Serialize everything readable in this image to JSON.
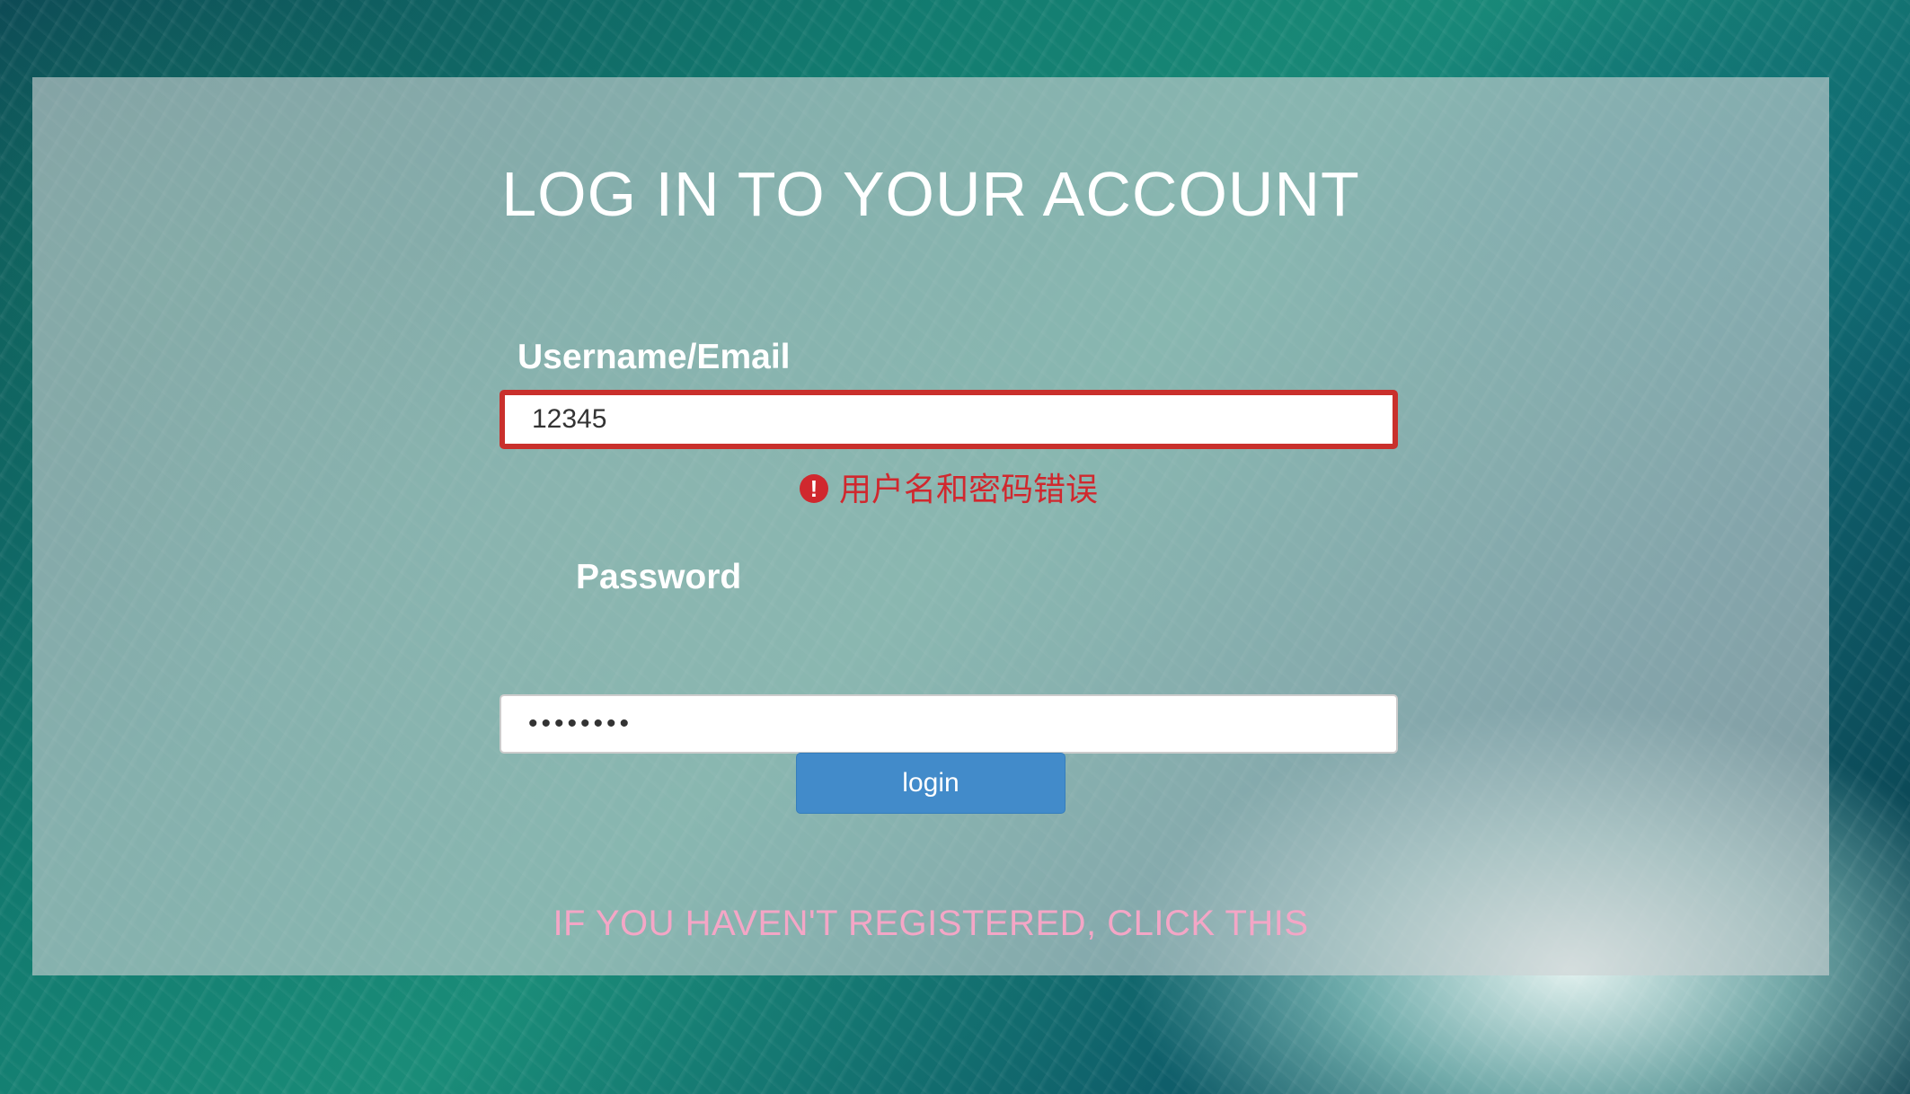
{
  "page": {
    "title": "LOG IN TO YOUR ACCOUNT"
  },
  "form": {
    "username": {
      "label": "Username/Email",
      "value": "12345",
      "error": "用户名和密码错误",
      "error_icon": "exclamation-circle-icon",
      "error_color": "#d0282e"
    },
    "password": {
      "label": "Password",
      "value": "••••••••"
    },
    "login_label": "login"
  },
  "register_link": "IF YOU HAVEN'T REGISTERED, CLICK THIS",
  "colors": {
    "button": "#428bca",
    "link": "#f4a6c6",
    "error_border": "#c9302c"
  }
}
